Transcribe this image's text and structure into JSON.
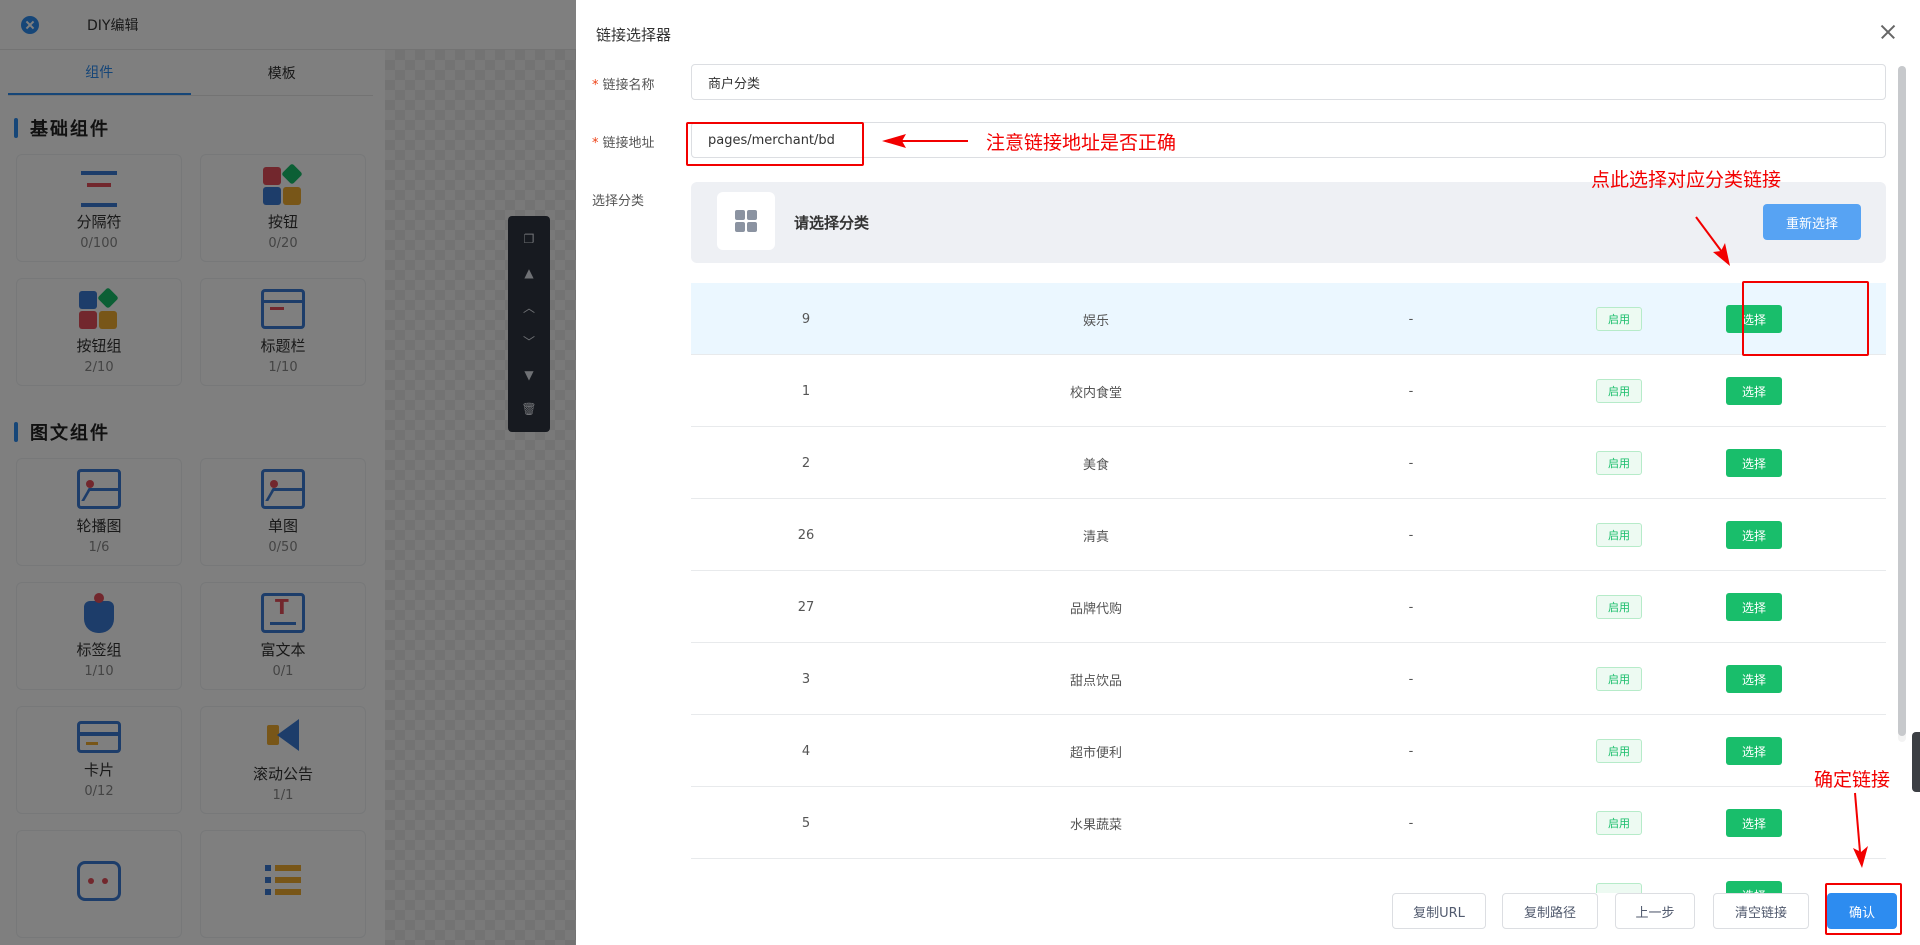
{
  "editor": {
    "title": "DIY编辑",
    "tabs": [
      "组件",
      "模板"
    ],
    "sections": [
      {
        "title": "基础组件",
        "items": [
          {
            "name": "分隔符",
            "count": "0/100",
            "icon": "separator-icon"
          },
          {
            "name": "按钮",
            "count": "0/20",
            "icon": "button-icon"
          },
          {
            "name": "按钮组",
            "count": "2/10",
            "icon": "button-group-icon"
          },
          {
            "name": "标题栏",
            "count": "1/10",
            "icon": "title-bar-icon"
          }
        ]
      },
      {
        "title": "图文组件",
        "items": [
          {
            "name": "轮播图",
            "count": "1/6",
            "icon": "carousel-icon"
          },
          {
            "name": "单图",
            "count": "0/50",
            "icon": "single-image-icon"
          },
          {
            "name": "标签组",
            "count": "1/10",
            "icon": "tag-group-icon"
          },
          {
            "name": "富文本",
            "count": "0/1",
            "icon": "rich-text-icon"
          },
          {
            "name": "卡片",
            "count": "0/12",
            "icon": "card-icon"
          },
          {
            "name": "滚动公告",
            "count": "1/1",
            "icon": "notice-icon"
          }
        ]
      }
    ]
  },
  "drawer": {
    "title": "链接选择器",
    "fields": {
      "name_label": "链接名称",
      "name_value": "商户分类",
      "url_label": "链接地址",
      "url_value": "pages/merchant/bd",
      "category_label": "选择分类"
    },
    "category": {
      "placeholder": "请选择分类",
      "reselect_label": "重新选择"
    },
    "rows": [
      {
        "id": "9",
        "name": "娱乐",
        "desc": "-",
        "status": "启用",
        "action": "选择"
      },
      {
        "id": "1",
        "name": "校内食堂",
        "desc": "-",
        "status": "启用",
        "action": "选择"
      },
      {
        "id": "2",
        "name": "美食",
        "desc": "-",
        "status": "启用",
        "action": "选择"
      },
      {
        "id": "26",
        "name": "清真",
        "desc": "-",
        "status": "启用",
        "action": "选择"
      },
      {
        "id": "27",
        "name": "品牌代购",
        "desc": "-",
        "status": "启用",
        "action": "选择"
      },
      {
        "id": "3",
        "name": "甜点饮品",
        "desc": "-",
        "status": "启用",
        "action": "选择"
      },
      {
        "id": "4",
        "name": "超市便利",
        "desc": "-",
        "status": "启用",
        "action": "选择"
      },
      {
        "id": "5",
        "name": "水果蔬菜",
        "desc": "-",
        "status": "启用",
        "action": "选择"
      },
      {
        "id": "",
        "name": "",
        "desc": "",
        "status": "",
        "action": "选择"
      }
    ],
    "footer": {
      "copy_url": "复制URL",
      "copy_path": "复制路径",
      "prev_step": "上一步",
      "clear_link": "清空链接",
      "confirm": "确认"
    }
  },
  "annotations": {
    "url_note": "注意链接地址是否正确",
    "select_note": "点此选择对应分类链接",
    "confirm_note": "确定链接"
  }
}
